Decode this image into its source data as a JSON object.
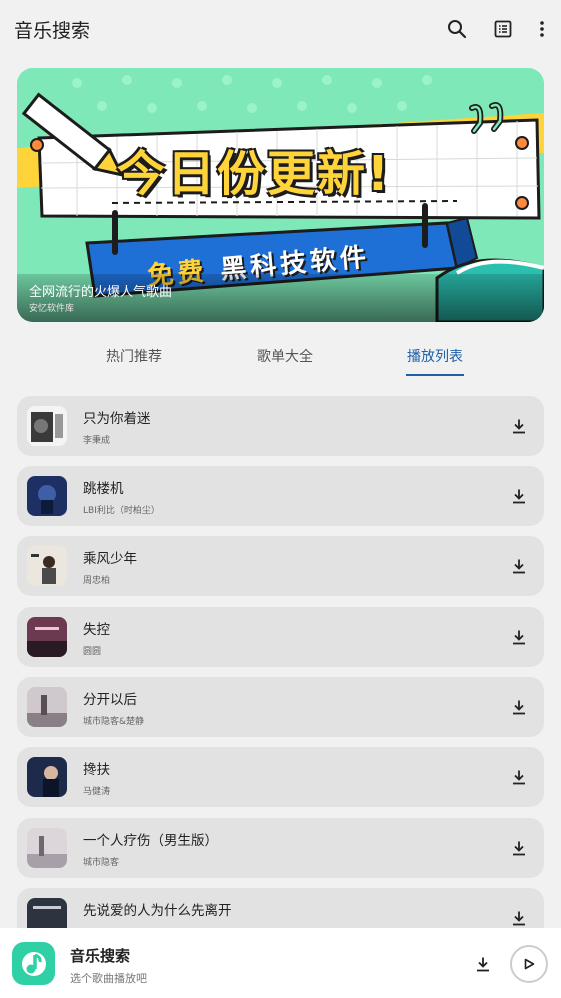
{
  "header": {
    "title": "音乐搜索",
    "icons": [
      "search-icon",
      "list-view-icon",
      "more-vertical-icon"
    ]
  },
  "banner": {
    "headline": "今日份更新!",
    "ribbon_free": "免费",
    "ribbon_text": "黑科技软件",
    "caption_title": "全网流行的火爆人气歌曲",
    "caption_subtitle": "安忆软件库",
    "colors": {
      "background": "#7ee8b8",
      "accent": "#ffd33a",
      "ribbon": "#1e6fd6"
    }
  },
  "tabs": [
    {
      "label": "热门推荐",
      "active": false
    },
    {
      "label": "歌单大全",
      "active": false
    },
    {
      "label": "播放列表",
      "active": true
    }
  ],
  "songs": [
    {
      "title": "只为你着迷",
      "artist": "李秉成",
      "thumb_color": "#3a3a3a"
    },
    {
      "title": "跳楼机",
      "artist": "LBI利比（时柏尘）",
      "thumb_color": "#1e2f63"
    },
    {
      "title": "乘风少年",
      "artist": "周忠柏",
      "thumb_color": "#d9d2c6"
    },
    {
      "title": "失控",
      "artist": "圆圆",
      "thumb_color": "#6b3a52"
    },
    {
      "title": "分开以后",
      "artist": "城市隐客&楚静",
      "thumb_color": "#8a7f86"
    },
    {
      "title": "搀扶",
      "artist": "马健涛",
      "thumb_color": "#1d2a4a"
    },
    {
      "title": "一个人疗伤（男生版）",
      "artist": "城市隐客",
      "thumb_color": "#a7a0a8"
    },
    {
      "title": "先说爱的人为什么先离开",
      "artist": "",
      "thumb_color": "#2c3440"
    }
  ],
  "player": {
    "title": "音乐搜索",
    "subtitle": "选个歌曲播放吧",
    "logo_color": "#2fd0a5"
  },
  "accent_color": "#1f5fa8"
}
